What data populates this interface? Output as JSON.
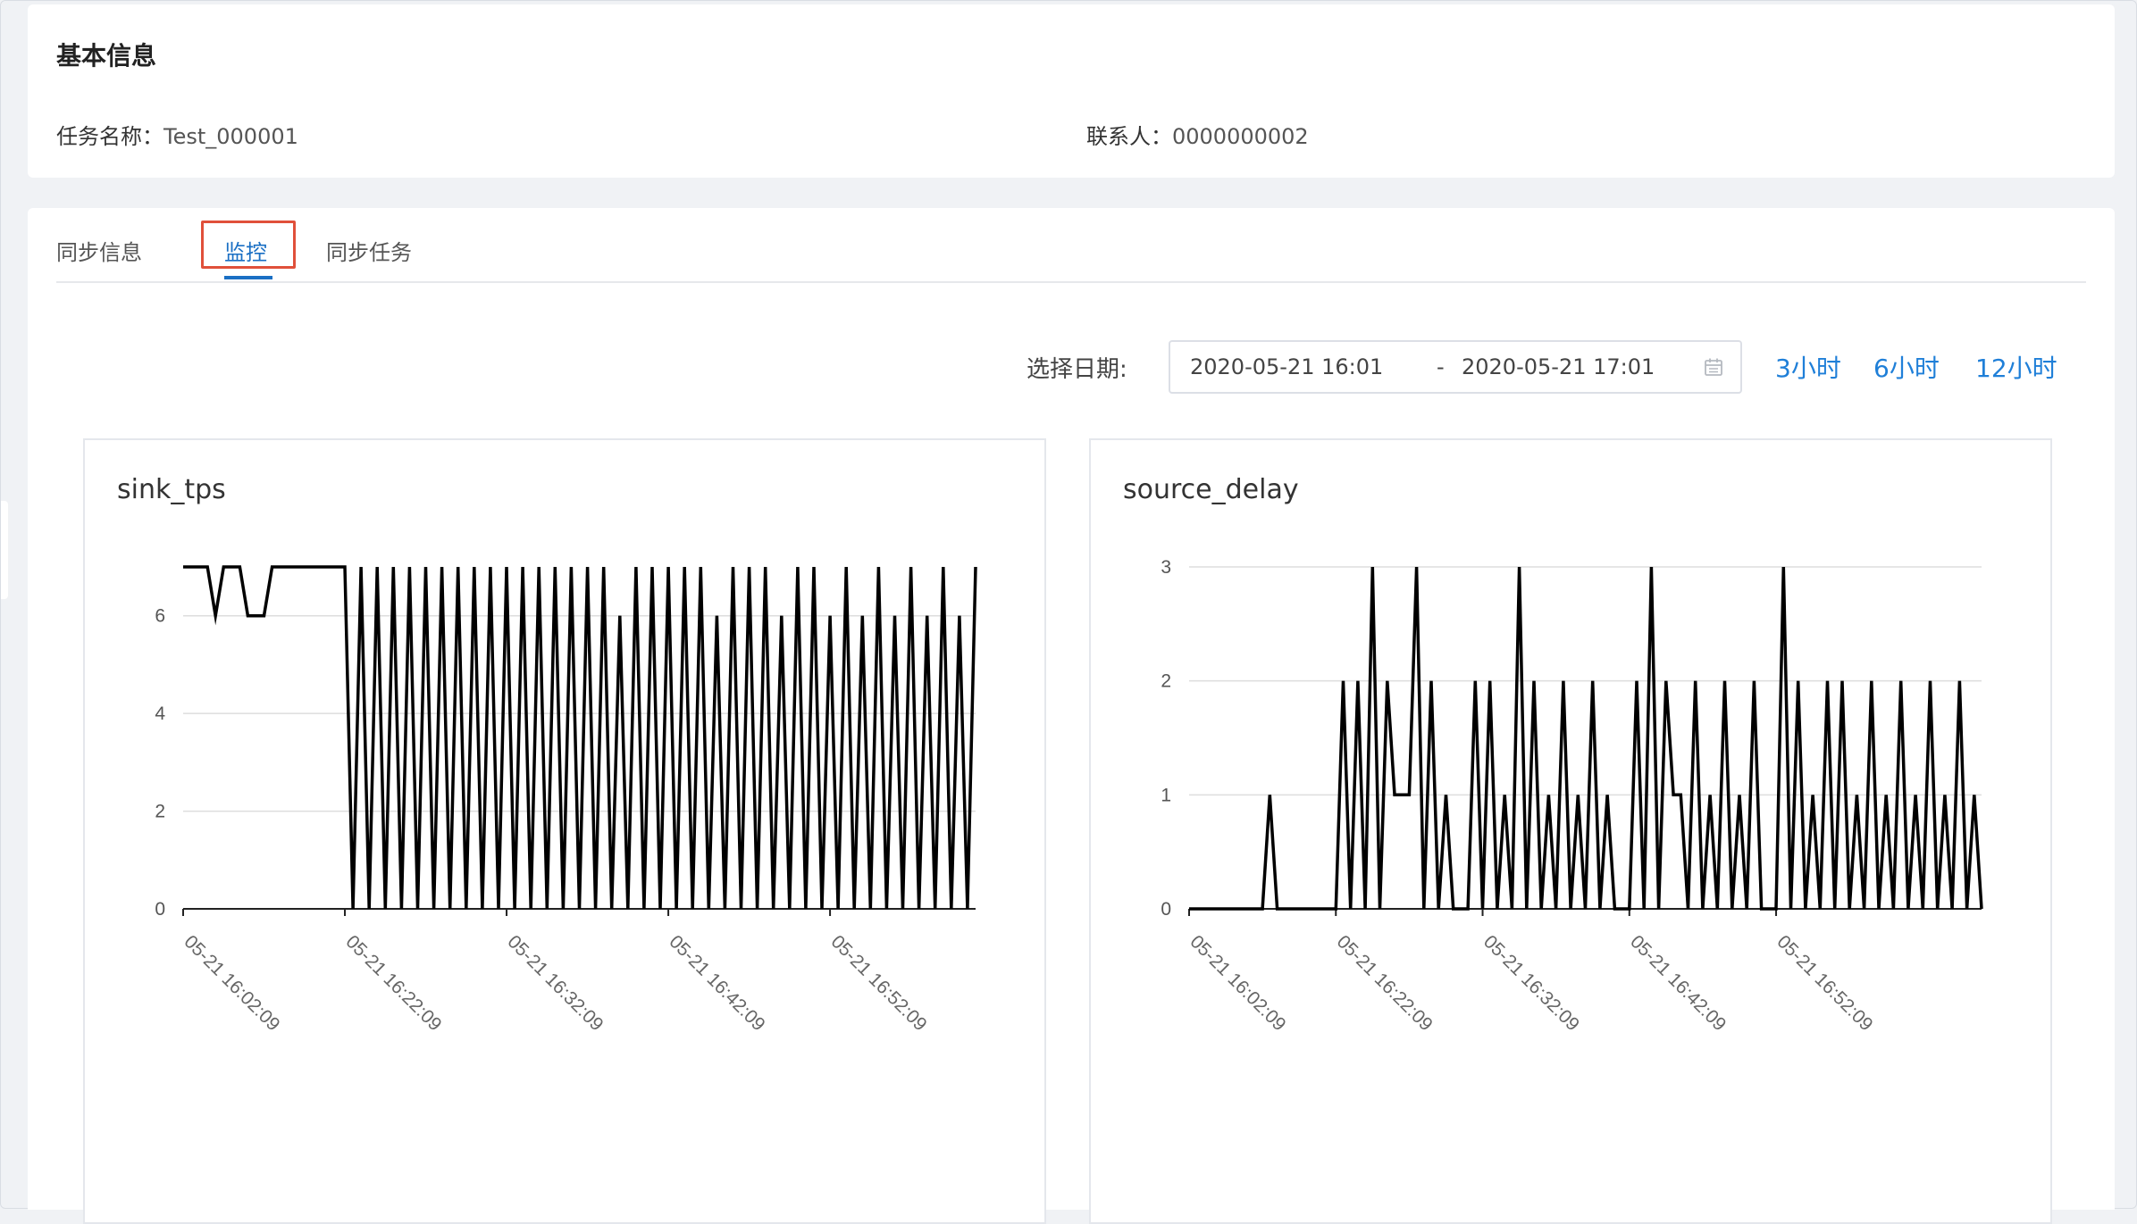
{
  "basic_info": {
    "title": "基本信息",
    "task_name_label": "任务名称：",
    "task_name": "Test_000001",
    "contact_label": "联系人：",
    "contact": "0000000002"
  },
  "tabs": [
    {
      "label": "同步信息",
      "active": false
    },
    {
      "label": "监控",
      "active": true
    },
    {
      "label": "同步任务",
      "active": false
    }
  ],
  "date_filter": {
    "label": "选择日期:",
    "start": "2020-05-21 16:01",
    "separator": "-",
    "end": "2020-05-21 17:01",
    "quick_ranges": [
      "3小时",
      "6小时",
      "12小时"
    ]
  },
  "colors": {
    "accent": "#1a6fc4",
    "link": "#1f7fd8",
    "highlight_box": "#e0503a",
    "line": "#000000",
    "grid": "#dddddd"
  },
  "chart_data": [
    {
      "type": "line",
      "title": "sink_tps",
      "ylim": [
        0,
        7
      ],
      "yticks": [
        0,
        2,
        4,
        6
      ],
      "xticks": [
        "05-21 16:02:09",
        "05-21 16:22:09",
        "05-21 16:32:09",
        "05-21 16:42:09",
        "05-21 16:52:09"
      ],
      "xtick_index": [
        0,
        20,
        40,
        60,
        80
      ],
      "grid": true,
      "values": [
        7,
        7,
        7,
        7,
        6,
        7,
        7,
        7,
        6,
        6,
        6,
        7,
        7,
        7,
        7,
        7,
        7,
        7,
        7,
        7,
        7,
        0,
        7,
        0,
        7,
        0,
        7,
        0,
        7,
        0,
        7,
        0,
        7,
        0,
        7,
        0,
        7,
        0,
        7,
        0,
        7,
        0,
        7,
        0,
        7,
        0,
        7,
        0,
        7,
        0,
        7,
        0,
        7,
        0,
        6,
        0,
        7,
        0,
        7,
        0,
        7,
        0,
        7,
        0,
        7,
        0,
        6,
        0,
        7,
        0,
        7,
        0,
        7,
        0,
        6,
        0,
        7,
        0,
        7,
        0,
        6,
        0,
        7,
        0,
        6,
        0,
        7,
        0,
        6,
        0,
        7,
        0,
        6,
        0,
        7,
        0,
        6,
        0,
        7
      ]
    },
    {
      "type": "line",
      "title": "source_delay",
      "ylim": [
        0,
        3
      ],
      "yticks": [
        0,
        1,
        2,
        3
      ],
      "xticks": [
        "05-21 16:02:09",
        "05-21 16:22:09",
        "05-21 16:32:09",
        "05-21 16:42:09",
        "05-21 16:52:09"
      ],
      "xtick_index": [
        0,
        20,
        40,
        60,
        80
      ],
      "grid": true,
      "values": [
        0,
        0,
        0,
        0,
        0,
        0,
        0,
        0,
        0,
        0,
        0,
        1,
        0,
        0,
        0,
        0,
        0,
        0,
        0,
        0,
        0,
        2,
        0,
        2,
        0,
        3,
        0,
        2,
        1,
        1,
        1,
        3,
        0,
        2,
        0,
        1,
        0,
        0,
        0,
        2,
        0,
        2,
        0,
        1,
        0,
        3,
        0,
        2,
        0,
        1,
        0,
        2,
        0,
        1,
        0,
        2,
        0,
        1,
        0,
        0,
        0,
        2,
        0,
        3,
        0,
        2,
        1,
        1,
        0,
        2,
        0,
        1,
        0,
        2,
        0,
        1,
        0,
        2,
        0,
        0,
        0,
        3,
        0,
        2,
        0,
        1,
        0,
        2,
        0,
        2,
        0,
        1,
        0,
        2,
        0,
        1,
        0,
        2,
        0,
        1,
        0,
        2,
        0,
        1,
        0,
        2,
        0,
        1,
        0
      ]
    }
  ]
}
